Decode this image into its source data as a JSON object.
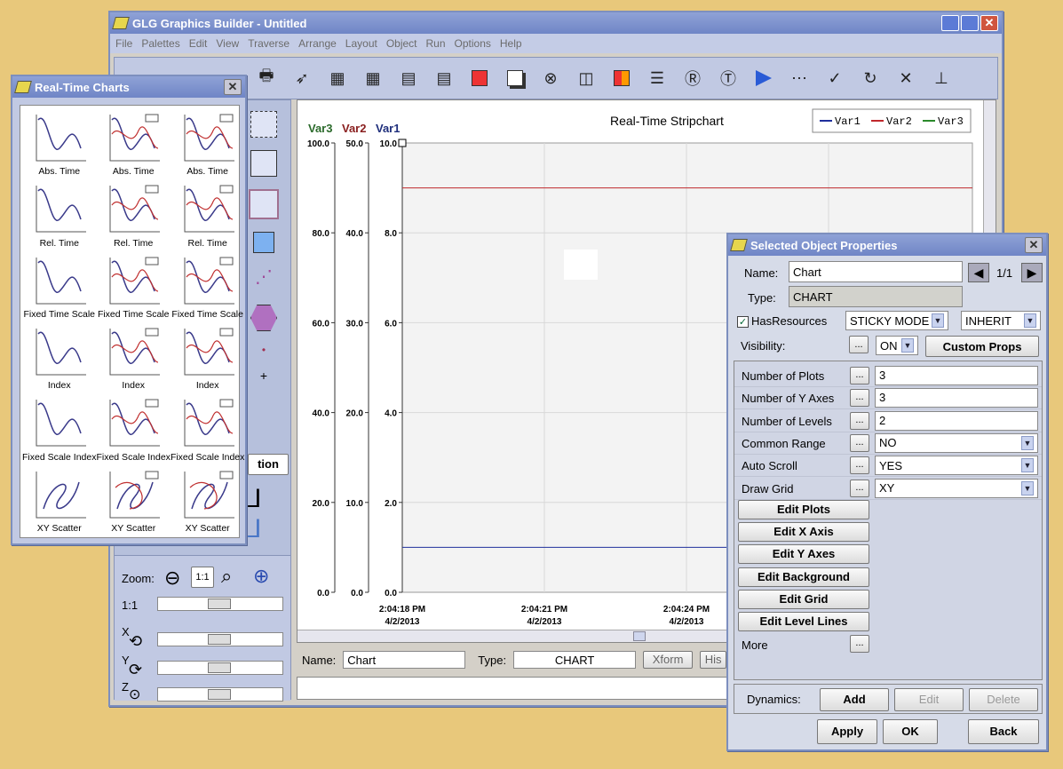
{
  "main_window": {
    "title": "GLG Graphics Builder - Untitled",
    "menu": [
      "File",
      "Palettes",
      "Edit",
      "View",
      "Traverse",
      "Arrange",
      "Layout",
      "Object",
      "Run",
      "Options",
      "Help"
    ]
  },
  "chart": {
    "title": "Real-Time Stripchart",
    "legend": [
      "Var1",
      "Var2",
      "Var3"
    ],
    "axis_titles": {
      "var3": "Var3",
      "var2": "Var2",
      "var1": "Var1"
    },
    "colors": {
      "var1": "#1f2f9c",
      "var2": "#c0282c",
      "var3": "#2b8a2b"
    }
  },
  "chart_data": {
    "type": "line",
    "title": "Real-Time Stripchart",
    "y_axes": [
      {
        "name": "Var3",
        "ticks": [
          "100.0",
          "80.0",
          "60.0",
          "40.0",
          "20.0",
          "0.0"
        ],
        "range": [
          0,
          100
        ]
      },
      {
        "name": "Var2",
        "ticks": [
          "50.0",
          "40.0",
          "30.0",
          "20.0",
          "10.0",
          "0.0"
        ],
        "range": [
          0,
          50
        ]
      },
      {
        "name": "Var1",
        "ticks": [
          "10.0",
          "8.0",
          "6.0",
          "4.0",
          "2.0",
          "0.0"
        ],
        "range": [
          0,
          10
        ]
      }
    ],
    "x_ticks": [
      {
        "time": "2:04:18 PM",
        "date": "4/2/2013"
      },
      {
        "time": "2:04:21 PM",
        "date": "4/2/2013"
      },
      {
        "time": "2:04:24 PM",
        "date": "4/2/2013"
      }
    ],
    "series": [
      {
        "name": "Var1",
        "values": [
          1.0,
          1.0
        ],
        "axis": "Var1"
      },
      {
        "name": "Var2",
        "values": [
          45,
          45
        ],
        "axis": "Var2"
      }
    ],
    "grid": true,
    "legend_position": "top-right"
  },
  "bottom": {
    "name_label": "Name:",
    "name_value": "Chart",
    "type_label": "Type:",
    "type_value": "CHART",
    "xform": "Xform",
    "his": "His"
  },
  "left_panel": {
    "zoom_label": "Zoom:",
    "zoom_11": "1:1",
    "ratio_label": "1:1",
    "option_btn": "tion",
    "rot_labels": [
      "X",
      "Y",
      "Z"
    ]
  },
  "rt_window": {
    "title": "Real-Time Charts",
    "items": [
      "Abs. Time",
      "Abs. Time",
      "Abs. Time",
      "Rel. Time",
      "Rel. Time",
      "Rel. Time",
      "Fixed Time Scale",
      "Fixed Time Scale",
      "Fixed Time Scale",
      "Index",
      "Index",
      "Index",
      "Fixed Scale Index",
      "Fixed Scale Index",
      "Fixed Scale Index",
      "XY Scatter",
      "XY Scatter",
      "XY Scatter"
    ]
  },
  "props": {
    "title": "Selected Object Properties",
    "name_label": "Name:",
    "name_value": "Chart",
    "counter": "1/1",
    "type_label": "Type:",
    "type_value": "CHART",
    "has_resources": "HasResources",
    "sticky": "STICKY MODE",
    "inherit": "INHERIT",
    "visibility_label": "Visibility:",
    "visibility_value": "ON",
    "custom_props": "Custom Props",
    "rows": [
      {
        "label": "Number of Plots",
        "value": "3"
      },
      {
        "label": "Number of Y Axes",
        "value": "3"
      },
      {
        "label": "Number of Levels",
        "value": "2"
      },
      {
        "label": "Common Range",
        "value": "NO"
      },
      {
        "label": "Auto Scroll",
        "value": "YES"
      },
      {
        "label": "Draw Grid",
        "value": "XY"
      }
    ],
    "edit_buttons": [
      "Edit Plots",
      "Edit X Axis",
      "Edit Y Axes",
      "Edit Background",
      "Edit Grid",
      "Edit Level Lines"
    ],
    "more_label": "More",
    "dots": "...",
    "dynamics_label": "Dynamics:",
    "add": "Add",
    "edit": "Edit",
    "delete": "Delete",
    "apply": "Apply",
    "ok": "OK",
    "back": "Back"
  }
}
